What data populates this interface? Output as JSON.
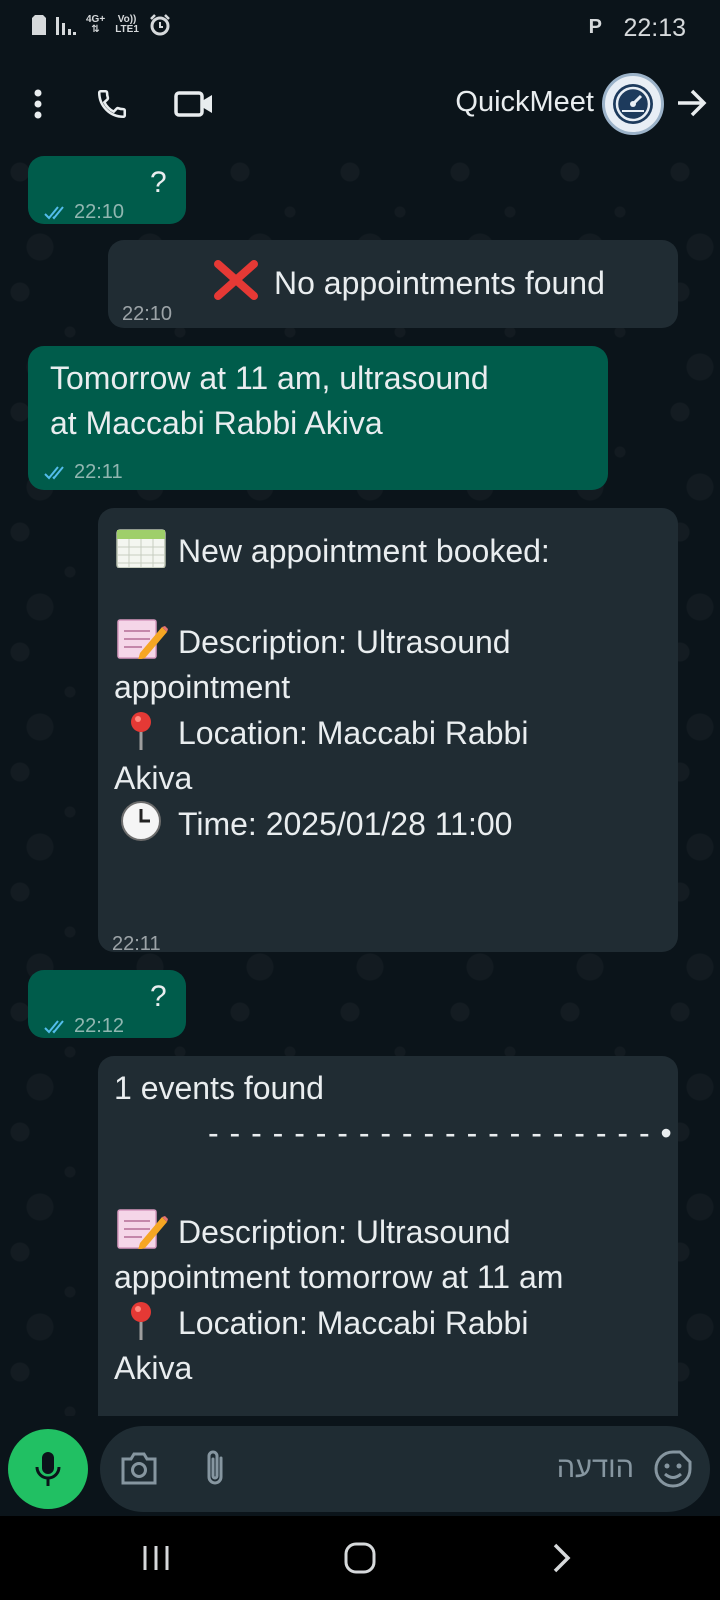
{
  "status_bar": {
    "network_top": "4G+",
    "network_bottom": "LTE1",
    "volte_top": "Vo))",
    "p_indicator": "P",
    "time": "22:13"
  },
  "header": {
    "contact_name": "QuickMeet",
    "icons": [
      "more-vertical-icon",
      "phone-icon",
      "video-camera-icon",
      "avatar",
      "arrow-right-icon"
    ]
  },
  "messages": [
    {
      "direction": "outgoing",
      "lines": [
        "?"
      ],
      "time": "22:10",
      "status": "read"
    },
    {
      "direction": "incoming",
      "emoji": "cross-mark-emoji",
      "lines": [
        "No appointments found"
      ],
      "time": "22:10"
    },
    {
      "direction": "outgoing",
      "lines": [
        "Tomorrow at 11 am, ultrasound",
        "at Maccabi Rabbi Akiva"
      ],
      "time": "22:11",
      "status": "read"
    },
    {
      "direction": "incoming",
      "time": "22:11",
      "lines": {
        "heading": "New appointment booked:",
        "description_1": "Description: Ultrasound",
        "description_2": "appointment",
        "location_1": "Location: Maccabi Rabbi",
        "location_2": "Akiva",
        "time_line": "Time: 2025/01/28 11:00"
      }
    },
    {
      "direction": "outgoing",
      "lines": [
        "?"
      ],
      "time": "22:12",
      "status": "read"
    },
    {
      "direction": "incoming",
      "lines": {
        "heading": "1 events found",
        "separator": "- - - - - - - - - - - - - - - - - - - - -   •",
        "description_1": "Description: Ultrasound",
        "description_2": "appointment tomorrow at 11 am",
        "location_1": "Location: Maccabi Rabbi",
        "location_2": "Akiva"
      }
    }
  ],
  "input": {
    "placeholder": "הודעה"
  },
  "colors": {
    "background": "#0b141a",
    "outgoing_bubble": "#005c4b",
    "incoming_bubble": "#202c33",
    "read_ticks": "#53bdeb",
    "mic_button": "#21c063"
  }
}
